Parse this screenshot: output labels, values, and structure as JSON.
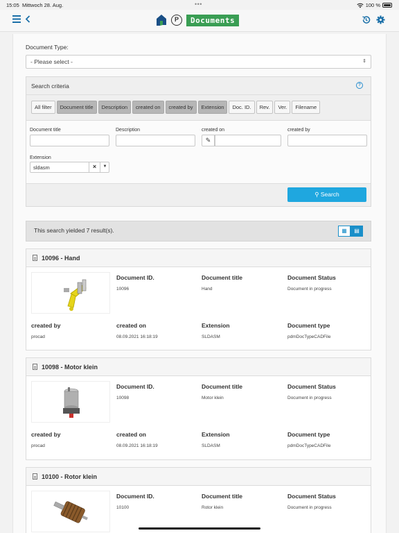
{
  "status_bar": {
    "time": "15:05",
    "date": "Mittwoch 28. Aug.",
    "dots": "•••",
    "battery": "100 %"
  },
  "header": {
    "title": "Documents",
    "p_badge": "P"
  },
  "document_type": {
    "label": "Document Type:",
    "selected": "- Please select -"
  },
  "search_criteria": {
    "title": "Search criteria",
    "chips": [
      {
        "label": "All filter",
        "active": false
      },
      {
        "label": "Document title",
        "active": true
      },
      {
        "label": "Description",
        "active": true
      },
      {
        "label": "created on",
        "active": true
      },
      {
        "label": "created by",
        "active": true
      },
      {
        "label": "Extension",
        "active": true
      },
      {
        "label": "Doc. ID.",
        "active": false
      },
      {
        "label": "Rev.",
        "active": false
      },
      {
        "label": "Ver.",
        "active": false
      },
      {
        "label": "Filename",
        "active": false
      }
    ],
    "fields": {
      "document_title": {
        "label": "Document title",
        "value": ""
      },
      "description": {
        "label": "Description",
        "value": ""
      },
      "created_on": {
        "label": "created on",
        "value": ""
      },
      "created_by": {
        "label": "created by",
        "value": ""
      },
      "extension": {
        "label": "Extension",
        "value": "sldasm"
      }
    },
    "search_button": "Search"
  },
  "results": {
    "summary": "This search yielded 7 result(s).",
    "cards": [
      {
        "title": "10096 - Hand",
        "doc_id_label": "Document ID.",
        "doc_id": "10096",
        "doc_title_label": "Document title",
        "doc_title": "Hand",
        "status_label": "Document Status",
        "status": "Document in progress",
        "created_by_label": "created by",
        "created_by": "procad",
        "created_on_label": "created on",
        "created_on": "08.09.2021 16:18:19",
        "extension_label": "Extension",
        "extension": "SLDASM",
        "doc_type_label": "Document type",
        "doc_type": "pdmDocTypeCADFile"
      },
      {
        "title": "10098 - Motor klein",
        "doc_id_label": "Document ID.",
        "doc_id": "10098",
        "doc_title_label": "Document title",
        "doc_title": "Motor klein",
        "status_label": "Document Status",
        "status": "Document in progress",
        "created_by_label": "created by",
        "created_by": "procad",
        "created_on_label": "created on",
        "created_on": "08.09.2021 16:18:19",
        "extension_label": "Extension",
        "extension": "SLDASM",
        "doc_type_label": "Document type",
        "doc_type": "pdmDocTypeCADFile"
      },
      {
        "title": "10100 - Rotor klein",
        "doc_id_label": "Document ID.",
        "doc_id": "10100",
        "doc_title_label": "Document title",
        "doc_title": "Rotor klein",
        "status_label": "Document Status",
        "status": "Document in progress"
      }
    ]
  },
  "colors": {
    "accent": "#1fa7df",
    "brand_green": "#3a9e54",
    "nav_icon": "#1a6fa8"
  }
}
